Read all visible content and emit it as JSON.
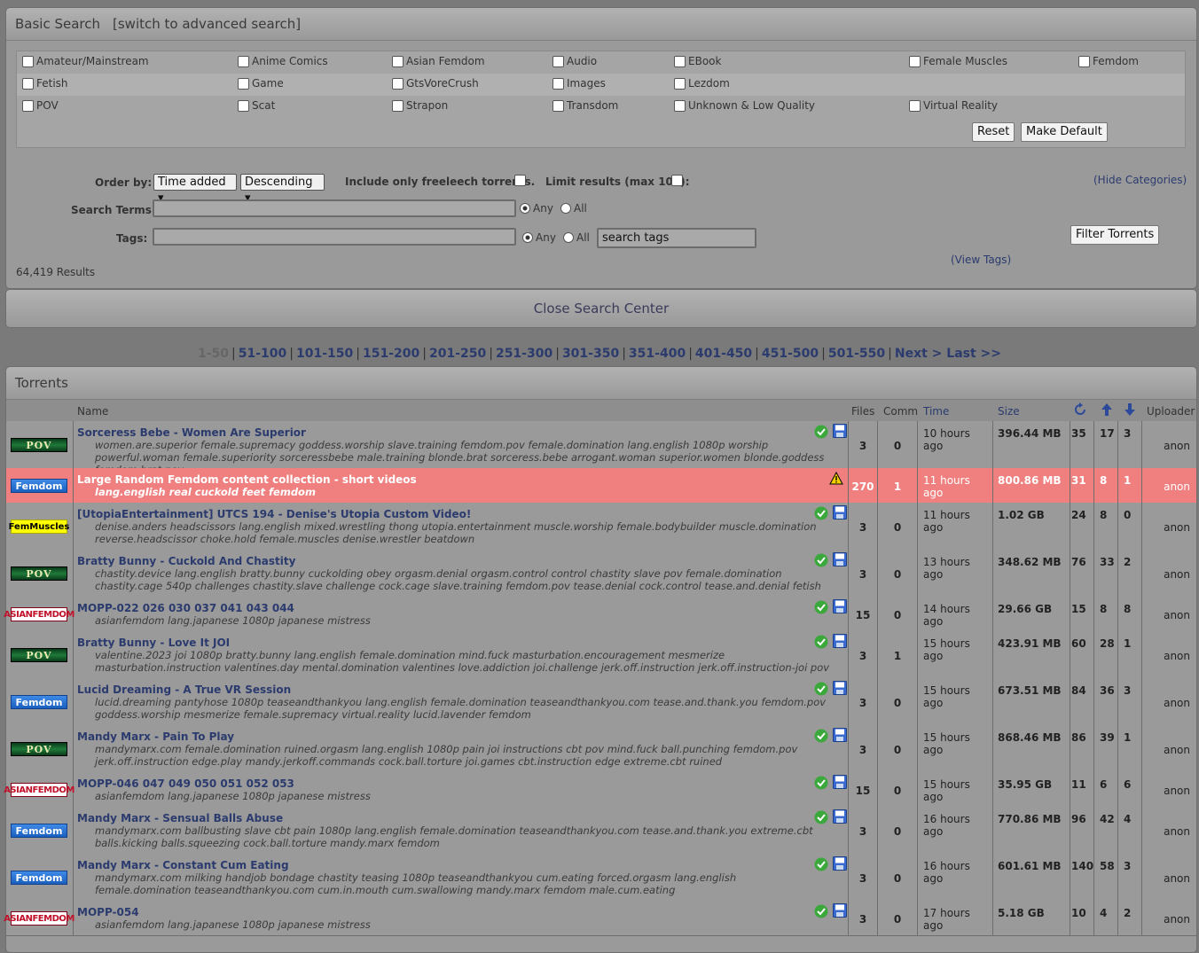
{
  "search": {
    "title": "Basic Search",
    "advanced_link": "[switch to advanced search]",
    "categories": [
      [
        "Amateur/Mainstream",
        "Anime Comics",
        "Asian Femdom",
        "Audio",
        "EBook",
        "Female Muscles",
        "Femdom"
      ],
      [
        "Fetish",
        "Game",
        "GtsVoreCrush",
        "Images",
        "Lezdom"
      ],
      [
        "POV",
        "Scat",
        "Strapon",
        "Transdom",
        "Unknown & Low Quality",
        "Virtual Reality"
      ]
    ],
    "reset_label": "Reset",
    "make_default_label": "Make Default",
    "order_by_label": "Order by:",
    "order_by_value": "Time added",
    "order_dir_value": "Descending",
    "freeleech_label": "Include only freeleech torrents.",
    "limit_label": "Limit results (max 100):",
    "hide_categories": "(Hide Categories)",
    "search_terms_label": "Search Terms:",
    "tags_label": "Tags:",
    "any_label": "Any",
    "all_label": "All",
    "search_tags_value": "search tags",
    "filter_label": "Filter Torrents",
    "view_tags": "(View Tags)",
    "results": "64,419 Results",
    "close_label": "Close Search Center"
  },
  "pager": {
    "current": "1-50",
    "pages": [
      "51-100",
      "101-150",
      "151-200",
      "201-250",
      "251-300",
      "301-350",
      "351-400",
      "401-450",
      "451-500",
      "501-550"
    ],
    "next": "Next >",
    "last": "Last >>"
  },
  "torrents": {
    "title": "Torrents",
    "headers": {
      "name": "Name",
      "files": "Files",
      "comm": "Comm",
      "time": "Time",
      "size": "Size",
      "uploader": "Uploader"
    },
    "rows": [
      {
        "cat": "POV",
        "badge": "pov",
        "title": "Sorceress Bebe - Women Are Superior",
        "tags": "women.are.superior female.supremacy goddess.worship slave.training femdom.pov female.domination lang.english 1080p worship powerful.woman female.superiority sorceressbebe male.training blonde.brat sorceress.bebe arrogant.woman superior.women blonde.goddess femdom.brat pov",
        "files": "3",
        "comm": "0",
        "time": "10 hours ago",
        "size": "396.44 MB",
        "snatched": "35",
        "seeders": "17",
        "leechers": "3",
        "uploader": "anon",
        "icons": "check-save"
      },
      {
        "cat": "Femdom",
        "badge": "fem",
        "title": "Large Random Femdom content collection - short videos",
        "tags": "lang.english real cuckold feet femdom",
        "files": "270",
        "comm": "1",
        "time": "11 hours ago",
        "size": "800.86 MB",
        "snatched": "31",
        "seeders": "8",
        "leechers": "1",
        "uploader": "anon",
        "icons": "warning",
        "highlight": true
      },
      {
        "cat": "FemMuscles",
        "badge": "fm",
        "title": "[UtopiaEntertainment] UTCS 194 - Denise's Utopia Custom Video!",
        "tags": "denise.anders headscissors lang.english mixed.wrestling thong utopia.entertainment muscle.worship female.bodybuilder muscle.domination reverse.headscissor choke.hold female.muscles denise.wrestler beatdown",
        "files": "3",
        "comm": "0",
        "time": "11 hours ago",
        "size": "1.02 GB",
        "snatched": "24",
        "seeders": "8",
        "leechers": "0",
        "uploader": "anon",
        "icons": "check-save"
      },
      {
        "cat": "POV",
        "badge": "pov",
        "title": "Bratty Bunny - Cuckold And Chastity",
        "tags": "chastity.device lang.english bratty.bunny cuckolding obey orgasm.denial orgasm.control control chastity slave pov female.domination chastity.cage 540p challenges chastity.slave challenge cock.cage slave.training femdom.pov tease.denial cock.control tease.and.denial fetish",
        "files": "3",
        "comm": "0",
        "time": "13 hours ago",
        "size": "348.62 MB",
        "snatched": "76",
        "seeders": "33",
        "leechers": "2",
        "uploader": "anon",
        "icons": "check-save"
      },
      {
        "cat": "ASIANFEMDOM",
        "badge": "asian",
        "title": "MOPP-022 026 030 037 041 043 044",
        "tags": "asianfemdom lang.japanese 1080p japanese mistress",
        "files": "15",
        "comm": "0",
        "time": "14 hours ago",
        "size": "29.66 GB",
        "snatched": "15",
        "seeders": "8",
        "leechers": "8",
        "uploader": "anon",
        "icons": "check-save"
      },
      {
        "cat": "POV",
        "badge": "pov",
        "title": "Bratty Bunny - Love It JOI",
        "tags": "valentine.2023 joi 1080p bratty.bunny lang.english female.domination mind.fuck masturbation.encouragement mesmerize masturbation.instruction valentines.day mental.domination valentines love.addiction joi.challenge jerk.off.instruction jerk.off.instruction-joi pov",
        "files": "3",
        "comm": "1",
        "time": "15 hours ago",
        "size": "423.91 MB",
        "snatched": "60",
        "seeders": "28",
        "leechers": "1",
        "uploader": "anon",
        "icons": "check-save"
      },
      {
        "cat": "Femdom",
        "badge": "fem",
        "title": "Lucid Dreaming - A True VR Session",
        "tags": "lucid.dreaming pantyhose 1080p teaseandthankyou lang.english female.domination teaseandthankyou.com tease.and.thank.you femdom.pov goddess.worship mesmerize female.supremacy virtual.reality lucid.lavender femdom",
        "files": "3",
        "comm": "0",
        "time": "15 hours ago",
        "size": "673.51 MB",
        "snatched": "84",
        "seeders": "36",
        "leechers": "3",
        "uploader": "anon",
        "icons": "check-save"
      },
      {
        "cat": "POV",
        "badge": "pov",
        "title": "Mandy Marx - Pain To Play",
        "tags": "mandymarx.com female.domination ruined.orgasm lang.english 1080p pain joi instructions cbt pov mind.fuck ball.punching femdom.pov jerk.off.instruction edge.play mandy.jerkoff.commands cock.ball.torture joi.games cbt.instruction edge extreme.cbt ruined",
        "files": "3",
        "comm": "0",
        "time": "15 hours ago",
        "size": "868.46 MB",
        "snatched": "86",
        "seeders": "39",
        "leechers": "1",
        "uploader": "anon",
        "icons": "check-save"
      },
      {
        "cat": "ASIANFEMDOM",
        "badge": "asian",
        "title": "MOPP-046 047 049 050 051 052 053",
        "tags": "asianfemdom lang.japanese 1080p japanese mistress",
        "files": "15",
        "comm": "0",
        "time": "15 hours ago",
        "size": "35.95 GB",
        "snatched": "11",
        "seeders": "6",
        "leechers": "6",
        "uploader": "anon",
        "icons": "check-save"
      },
      {
        "cat": "Femdom",
        "badge": "fem",
        "title": "Mandy Marx - Sensual Balls Abuse",
        "tags": "mandymarx.com ballbusting slave cbt pain 1080p lang.english female.domination teaseandthankyou.com tease.and.thank.you extreme.cbt balls.kicking balls.squeezing cock.ball.torture mandy.marx femdom",
        "files": "3",
        "comm": "0",
        "time": "16 hours ago",
        "size": "770.86 MB",
        "snatched": "96",
        "seeders": "42",
        "leechers": "4",
        "uploader": "anon",
        "icons": "check-save"
      },
      {
        "cat": "Femdom",
        "badge": "fem",
        "title": "Mandy Marx - Constant Cum Eating",
        "tags": "mandymarx.com milking handjob bondage chastity teasing 1080p teaseandthankyou cum.eating forced.orgasm lang.english female.domination teaseandthankyou.com cum.in.mouth cum.swallowing mandy.marx femdom male.cum.eating",
        "files": "3",
        "comm": "0",
        "time": "16 hours ago",
        "size": "601.61 MB",
        "snatched": "140",
        "seeders": "58",
        "leechers": "3",
        "uploader": "anon",
        "icons": "check-save"
      },
      {
        "cat": "ASIANFEMDOM",
        "badge": "asian",
        "title": "MOPP-054",
        "tags": "asianfemdom lang.japanese 1080p japanese mistress",
        "files": "3",
        "comm": "0",
        "time": "17 hours ago",
        "size": "5.18 GB",
        "snatched": "10",
        "seeders": "4",
        "leechers": "2",
        "uploader": "anon",
        "icons": "check-save"
      }
    ]
  },
  "colors": {
    "link": "#2b3b6e",
    "highlight_row": "#f08080",
    "panel": "#9a9a9a"
  }
}
